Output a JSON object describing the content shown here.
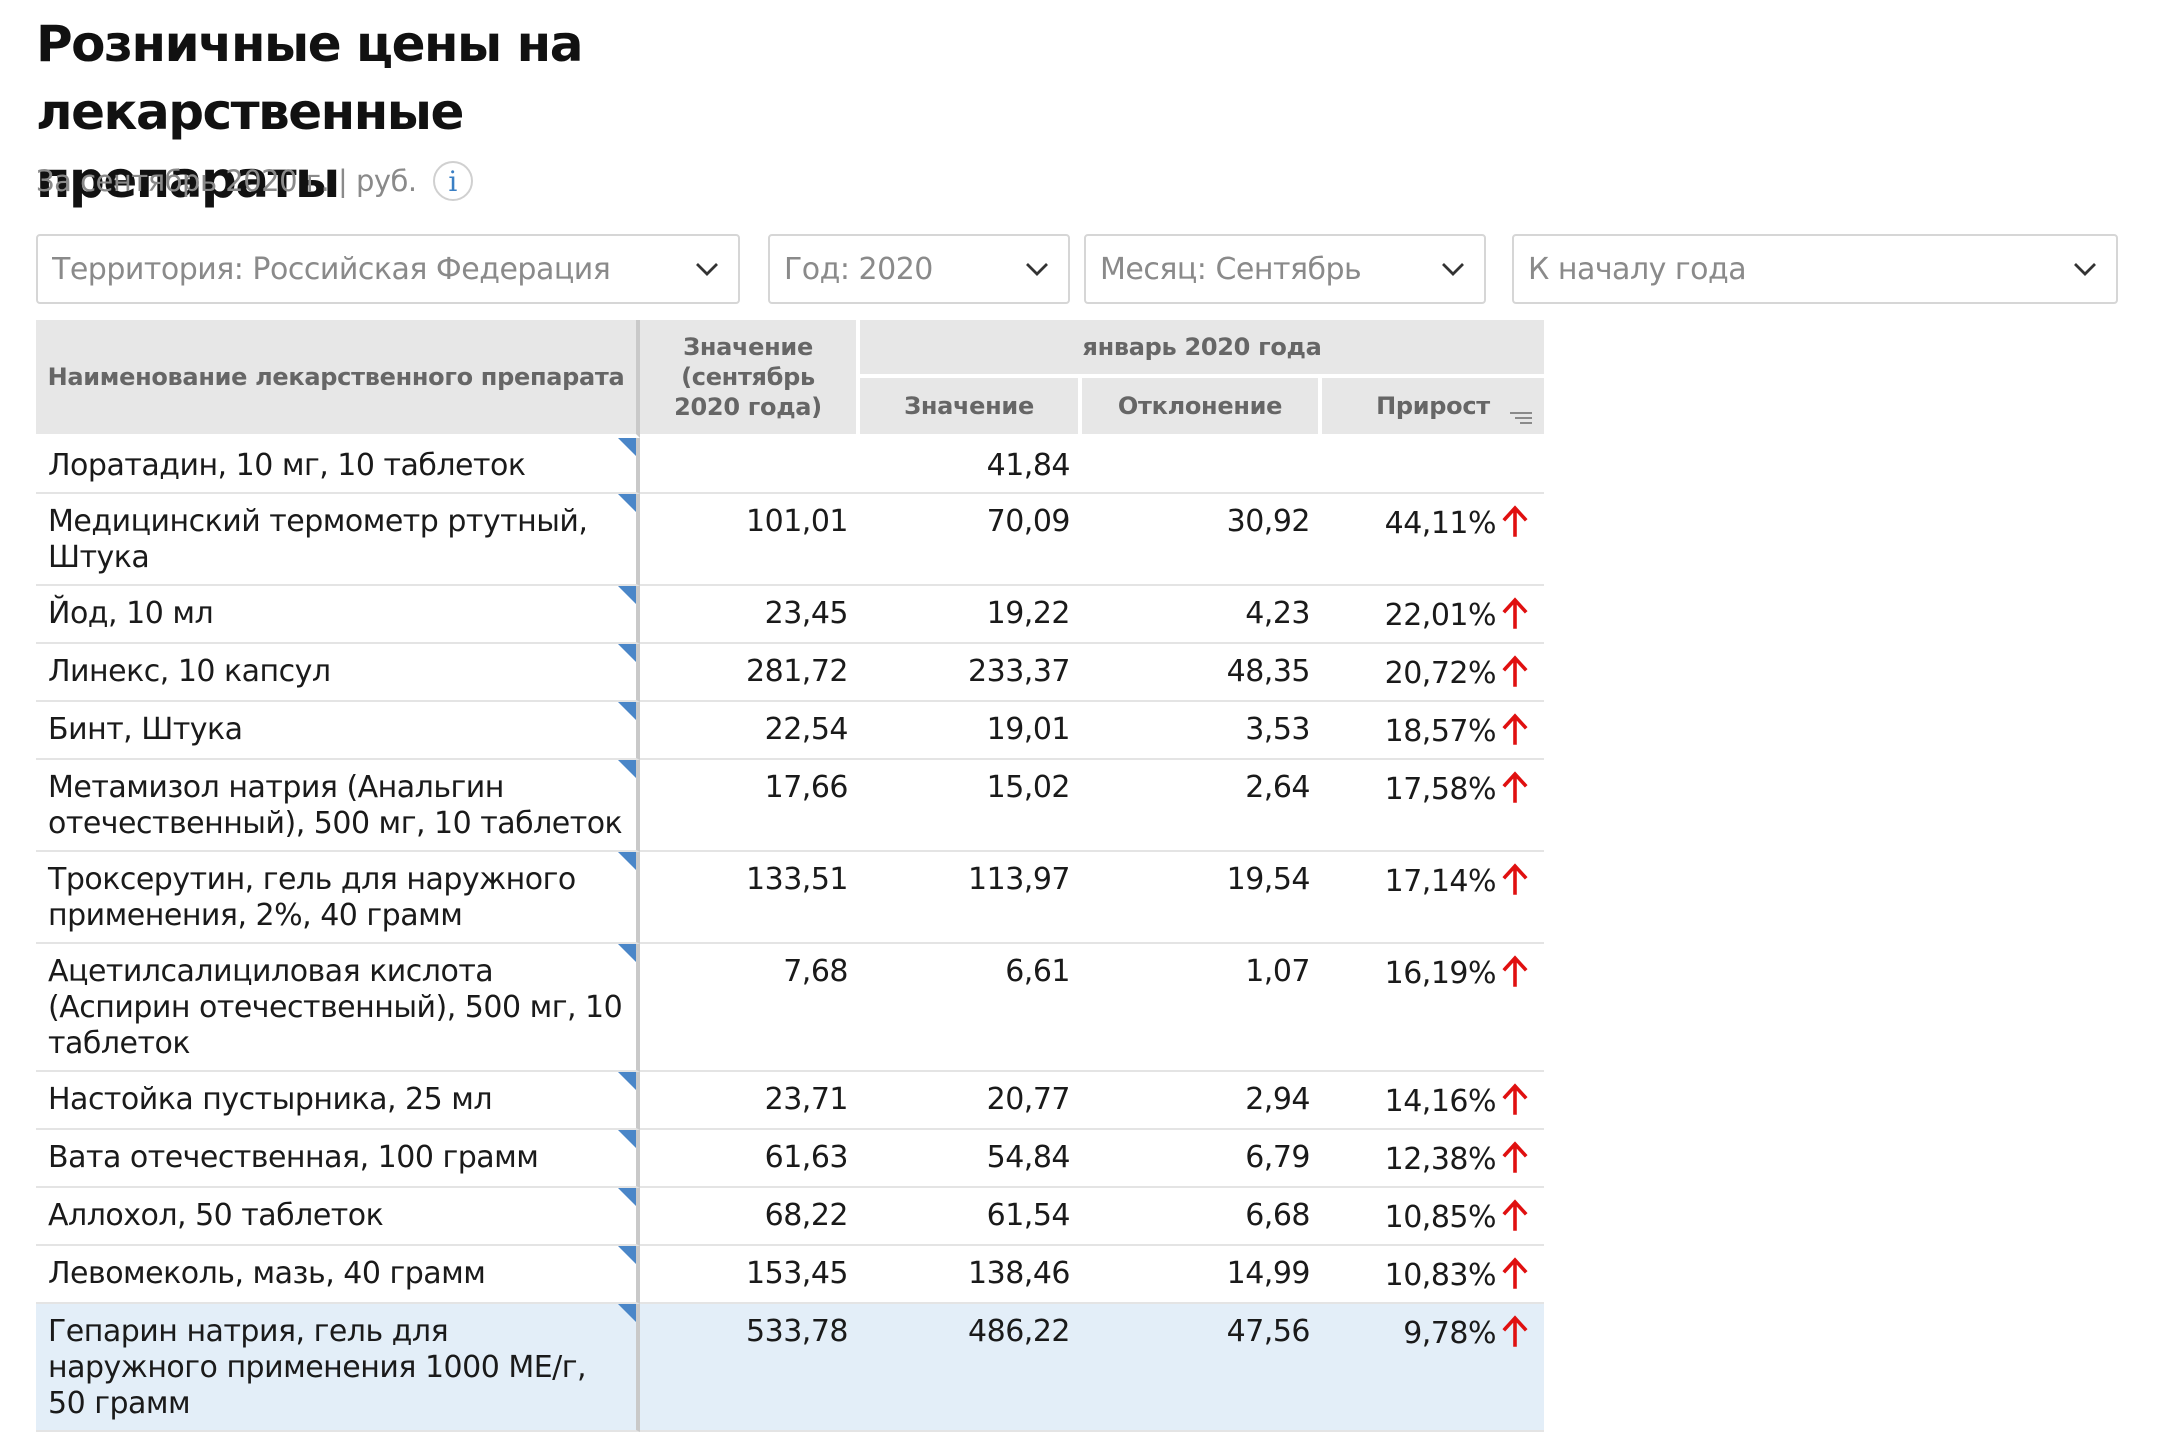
{
  "page": {
    "title_line1": "Розничные цены на лекарственные",
    "title_line2": "препараты",
    "subtitle": "За сентябрь 2020 г. | руб.",
    "info_glyph": "i"
  },
  "filters": {
    "territory": "Территория: Российская  Федерация",
    "year": "Год: 2020",
    "month": "Месяц: Сентябрь",
    "period": "К началу года"
  },
  "table": {
    "headers": {
      "name": "Наименование лекарственного препарата",
      "value_current": "Значение (сентябрь 2020 года)",
      "group": "январь 2020 года",
      "value_base": "Значение",
      "deviation": "Отклонение",
      "growth": "Прирост"
    },
    "rows": [
      {
        "name": "Лоратадин, 10 мг, 10 таблеток",
        "current": "",
        "base": "41,84",
        "deviation": "",
        "growth": "",
        "trend": ""
      },
      {
        "name": "Медицинский термометр ртутный, Штука",
        "current": "101,01",
        "base": "70,09",
        "deviation": "30,92",
        "growth": "44,11%",
        "trend": "up"
      },
      {
        "name": "Йод, 10 мл",
        "current": "23,45",
        "base": "19,22",
        "deviation": "4,23",
        "growth": "22,01%",
        "trend": "up"
      },
      {
        "name": "Линекс, 10 капсул",
        "current": "281,72",
        "base": "233,37",
        "deviation": "48,35",
        "growth": "20,72%",
        "trend": "up"
      },
      {
        "name": "Бинт, Штука",
        "current": "22,54",
        "base": "19,01",
        "deviation": "3,53",
        "growth": "18,57%",
        "trend": "up"
      },
      {
        "name": "Метамизол натрия (Анальгин отечественный), 500 мг, 10 таблеток",
        "current": "17,66",
        "base": "15,02",
        "deviation": "2,64",
        "growth": "17,58%",
        "trend": "up"
      },
      {
        "name": "Троксерутин, гель для наружного применения, 2%, 40 грамм",
        "current": "133,51",
        "base": "113,97",
        "deviation": "19,54",
        "growth": "17,14%",
        "trend": "up"
      },
      {
        "name": "Ацетилсалициловая кислота (Аспирин отечественный), 500 мг, 10 таблеток",
        "current": "7,68",
        "base": "6,61",
        "deviation": "1,07",
        "growth": "16,19%",
        "trend": "up"
      },
      {
        "name": "Настойка пустырника, 25 мл",
        "current": "23,71",
        "base": "20,77",
        "deviation": "2,94",
        "growth": "14,16%",
        "trend": "up"
      },
      {
        "name": "Вата отечественная, 100 грамм",
        "current": "61,63",
        "base": "54,84",
        "deviation": "6,79",
        "growth": "12,38%",
        "trend": "up"
      },
      {
        "name": "Аллохол, 50 таблеток",
        "current": "68,22",
        "base": "61,54",
        "deviation": "6,68",
        "growth": "10,85%",
        "trend": "up"
      },
      {
        "name": "Левомеколь, мазь, 40 грамм",
        "current": "153,45",
        "base": "138,46",
        "deviation": "14,99",
        "growth": "10,83%",
        "trend": "up"
      },
      {
        "name": "Гепарин натрия, гель для наружного применения 1000 МЕ/г, 50 грамм",
        "current": "533,78",
        "base": "486,22",
        "deviation": "47,56",
        "growth": "9,78%",
        "trend": "up",
        "highlighted": true
      }
    ]
  },
  "colors": {
    "accent": "#4a86c8",
    "trend_up": "#e01010",
    "header_bg": "#e7e7e7",
    "highlight_bg": "#e3eef8"
  },
  "icons": {
    "dropdown": "chevron-down-icon",
    "info": "info-icon",
    "trend_up": "arrow-up-icon",
    "sort": "sort-icon",
    "row_marker": "corner-triangle-icon"
  }
}
